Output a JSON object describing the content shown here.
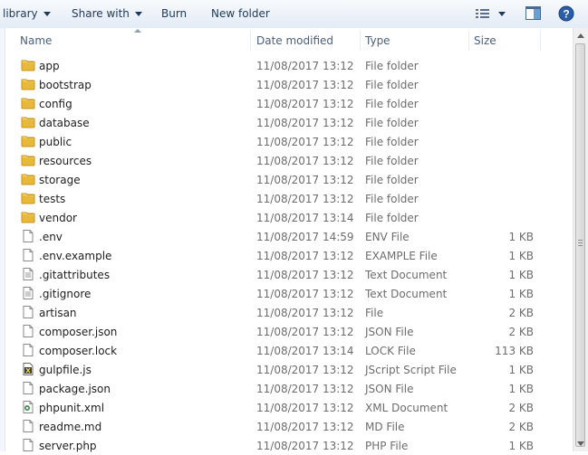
{
  "toolbar": {
    "library_label": "library",
    "share_label": "Share with",
    "burn_label": "Burn",
    "new_folder_label": "New folder"
  },
  "columns": {
    "name": "Name",
    "date": "Date modified",
    "type": "Type",
    "size": "Size"
  },
  "files": [
    {
      "name": "app",
      "date": "11/08/2017 13:12",
      "type": "File folder",
      "size": "",
      "icon": "folder-icon"
    },
    {
      "name": "bootstrap",
      "date": "11/08/2017 13:12",
      "type": "File folder",
      "size": "",
      "icon": "folder-icon"
    },
    {
      "name": "config",
      "date": "11/08/2017 13:12",
      "type": "File folder",
      "size": "",
      "icon": "folder-icon"
    },
    {
      "name": "database",
      "date": "11/08/2017 13:12",
      "type": "File folder",
      "size": "",
      "icon": "folder-icon"
    },
    {
      "name": "public",
      "date": "11/08/2017 13:12",
      "type": "File folder",
      "size": "",
      "icon": "folder-icon"
    },
    {
      "name": "resources",
      "date": "11/08/2017 13:12",
      "type": "File folder",
      "size": "",
      "icon": "folder-icon"
    },
    {
      "name": "storage",
      "date": "11/08/2017 13:12",
      "type": "File folder",
      "size": "",
      "icon": "folder-icon"
    },
    {
      "name": "tests",
      "date": "11/08/2017 13:12",
      "type": "File folder",
      "size": "",
      "icon": "folder-icon"
    },
    {
      "name": "vendor",
      "date": "11/08/2017 13:14",
      "type": "File folder",
      "size": "",
      "icon": "folder-icon"
    },
    {
      "name": ".env",
      "date": "11/08/2017 14:59",
      "type": "ENV File",
      "size": "1 KB",
      "icon": "file-icon"
    },
    {
      "name": ".env.example",
      "date": "11/08/2017 13:12",
      "type": "EXAMPLE File",
      "size": "1 KB",
      "icon": "file-icon"
    },
    {
      "name": ".gitattributes",
      "date": "11/08/2017 13:12",
      "type": "Text Document",
      "size": "1 KB",
      "icon": "text-file-icon"
    },
    {
      "name": ".gitignore",
      "date": "11/08/2017 13:12",
      "type": "Text Document",
      "size": "1 KB",
      "icon": "text-file-icon"
    },
    {
      "name": "artisan",
      "date": "11/08/2017 13:12",
      "type": "File",
      "size": "2 KB",
      "icon": "file-icon"
    },
    {
      "name": "composer.json",
      "date": "11/08/2017 13:12",
      "type": "JSON File",
      "size": "2 KB",
      "icon": "file-icon"
    },
    {
      "name": "composer.lock",
      "date": "11/08/2017 13:14",
      "type": "LOCK File",
      "size": "113 KB",
      "icon": "file-icon"
    },
    {
      "name": "gulpfile.js",
      "date": "11/08/2017 13:12",
      "type": "JScript Script File",
      "size": "1 KB",
      "icon": "script-file-icon"
    },
    {
      "name": "package.json",
      "date": "11/08/2017 13:12",
      "type": "JSON File",
      "size": "1 KB",
      "icon": "file-icon"
    },
    {
      "name": "phpunit.xml",
      "date": "11/08/2017 13:12",
      "type": "XML Document",
      "size": "2 KB",
      "icon": "xml-file-icon"
    },
    {
      "name": "readme.md",
      "date": "11/08/2017 13:12",
      "type": "MD File",
      "size": "2 KB",
      "icon": "file-icon"
    },
    {
      "name": "server.php",
      "date": "11/08/2017 13:12",
      "type": "PHP File",
      "size": "1 KB",
      "icon": "file-icon"
    }
  ],
  "colors": {
    "toolbar_text": "#1e395b",
    "folder": "#e8b838",
    "secondary_text": "#6d6d6d",
    "help_icon": "#2a5ea8"
  }
}
